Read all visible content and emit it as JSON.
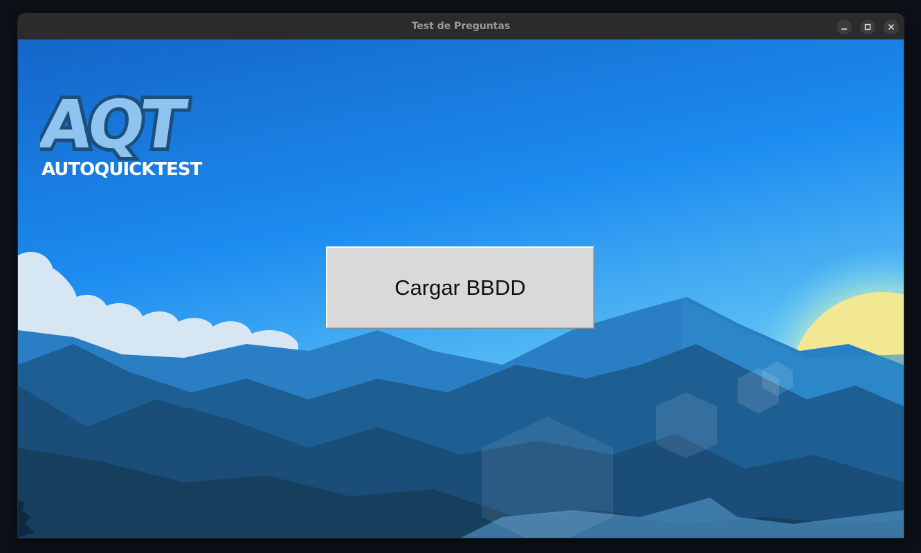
{
  "window": {
    "title": "Test de Preguntas",
    "controls": [
      "minimize-icon",
      "maximize-icon",
      "close-icon"
    ]
  },
  "logo": {
    "mark": "AQT",
    "wordmark": "AUTOQUICKTEST"
  },
  "main": {
    "load_button_label": "Cargar BBDD"
  },
  "colors": {
    "sky_top": "#1466c8",
    "sky_mid": "#1c8cf0",
    "sky_low": "#5cc0f4",
    "sun": "#f2e894",
    "cloud": "#d6e6f2",
    "mountain_far": "#2a7fc4",
    "mountain_mid": "#1e5f93",
    "mountain_near": "#163f5e",
    "logo_fill": "#8fc3f0",
    "logo_outline": "#1c4f7c",
    "button_bg": "#d9d9d9"
  }
}
